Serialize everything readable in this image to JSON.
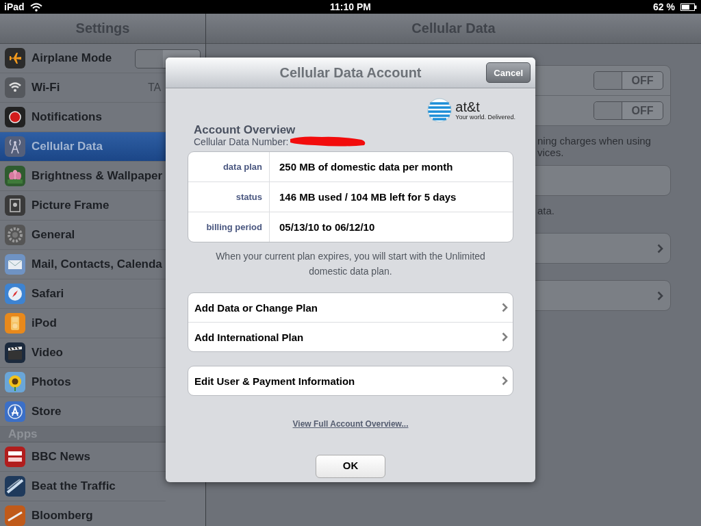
{
  "status_bar": {
    "device": "iPad",
    "time": "11:10 PM",
    "battery": "62 %"
  },
  "sidebar": {
    "title": "Settings",
    "items": [
      {
        "label": "Airplane Mode",
        "selected": false,
        "toggle": {
          "on": false
        }
      },
      {
        "label": "Wi-Fi",
        "selected": false,
        "value": "TA"
      },
      {
        "label": "Notifications",
        "selected": false
      },
      {
        "label": "Cellular Data",
        "selected": true
      },
      {
        "label": "Brightness & Wallpaper",
        "selected": false
      },
      {
        "label": "Picture Frame",
        "selected": false
      },
      {
        "label": "General",
        "selected": false
      },
      {
        "label": "Mail, Contacts, Calenda",
        "selected": false
      },
      {
        "label": "Safari",
        "selected": false
      },
      {
        "label": "iPod",
        "selected": false
      },
      {
        "label": "Video",
        "selected": false
      },
      {
        "label": "Photos",
        "selected": false
      },
      {
        "label": "Store",
        "selected": false
      }
    ],
    "section": "Apps",
    "apps": [
      {
        "label": "BBC News",
        "selected": false
      },
      {
        "label": "Beat the Traffic",
        "selected": false
      },
      {
        "label": "Bloomberg",
        "selected": false
      }
    ]
  },
  "detail": {
    "title": "Cellular Data",
    "toggles": [
      {
        "label": "OFF",
        "on": false
      },
      {
        "label": "OFF",
        "on": false
      }
    ],
    "note_lines": [
      "ning charges when using",
      "vices."
    ],
    "note2": "ata."
  },
  "dialog": {
    "title": "Cellular Data Account",
    "cancel": "Cancel",
    "logo": {
      "name": "at&t",
      "tagline": "Your world. Delivered."
    },
    "heading": "Account Overview",
    "number_label": "Cellular Data Number:",
    "details": [
      {
        "label": "data plan",
        "value": "250 MB of domestic data per month"
      },
      {
        "label": "status",
        "value": "146 MB used / 104 MB left for 5 days"
      },
      {
        "label": "billing period",
        "value": "05/13/10 to 06/12/10"
      }
    ],
    "note": "When your current plan expires, you will start with the Unlimited domestic data plan.",
    "action_groups": [
      [
        "Add Data or Change Plan",
        "Add International Plan"
      ],
      [
        "Edit User & Payment Information"
      ]
    ],
    "link": "View Full Account Overview...",
    "ok": "OK"
  }
}
